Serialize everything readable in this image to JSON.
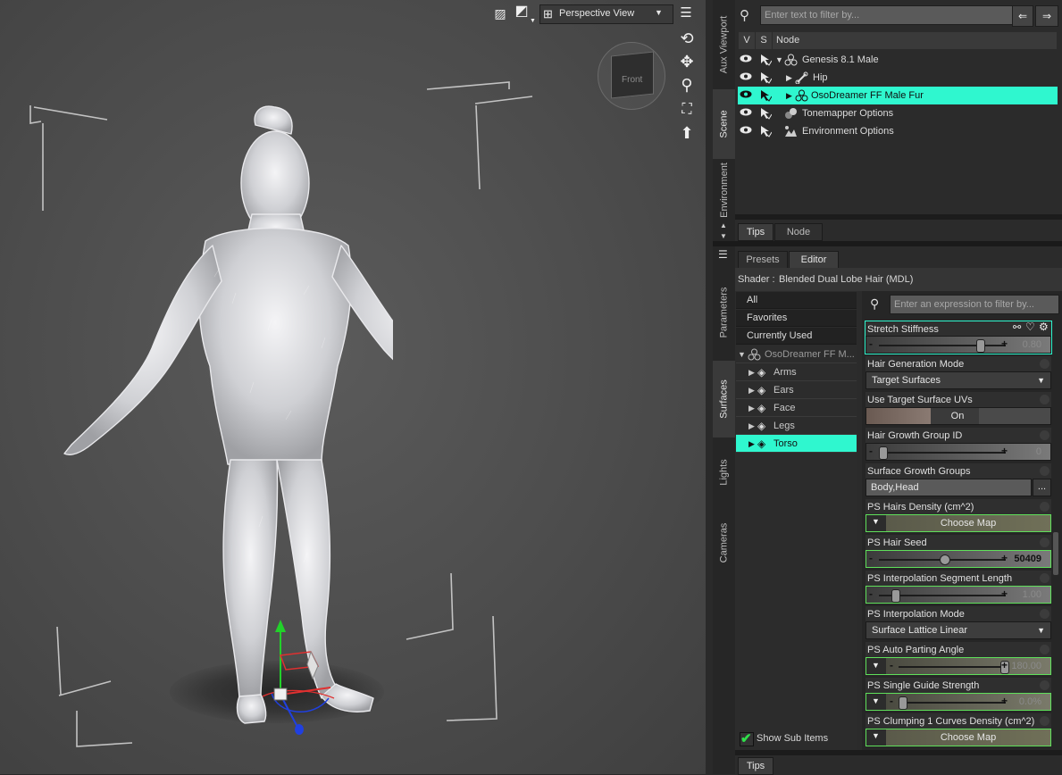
{
  "viewport": {
    "camera_label": "Perspective View",
    "navcube_label": "Front",
    "icons": [
      "render-icon",
      "shading-icon",
      "camera-icon",
      "viewport-menu-icon",
      "orbit-icon",
      "pan-icon",
      "zoom-icon",
      "frame-icon",
      "reset-icon"
    ]
  },
  "side_tabs_upper": [
    "Aux Viewport",
    "Scene",
    "Environment"
  ],
  "side_tabs_lower": [
    "Parameters",
    "Surfaces",
    "Lights",
    "Cameras"
  ],
  "scene": {
    "filter_placeholder": "Enter text to filter by...",
    "columns": {
      "v": "V",
      "s": "S",
      "node": "Node"
    },
    "nodes": [
      {
        "label": "Genesis 8.1 Male",
        "expanded": true,
        "selected": false,
        "icon": "figure-icon"
      },
      {
        "label": "Hip",
        "expanded": false,
        "selected": false,
        "icon": "bone-icon"
      },
      {
        "label": "OsoDreamer FF Male Fur",
        "expanded": false,
        "selected": true,
        "icon": "figure-icon"
      },
      {
        "label": "Tonemapper Options",
        "expanded": false,
        "selected": false,
        "icon": "tonemapper-icon"
      },
      {
        "label": "Environment Options",
        "expanded": false,
        "selected": false,
        "icon": "environment-icon"
      }
    ],
    "bottom_tabs": [
      "Tips",
      "Node"
    ]
  },
  "surfaces": {
    "tabs": [
      "Presets",
      "Editor"
    ],
    "active_tab": "Editor",
    "shader_label": "Shader :",
    "shader_name": "Blended Dual Lobe Hair (MDL)",
    "filters": [
      "All",
      "Favorites",
      "Currently Used"
    ],
    "group": "OsoDreamer FF M...",
    "items": [
      "Arms",
      "Ears",
      "Face",
      "Legs",
      "Torso"
    ],
    "selected_item": "Torso",
    "filter_placeholder": "Enter an expression to filter by...",
    "show_sub_items": "Show Sub Items",
    "bottom_tab": "Tips",
    "properties": [
      {
        "label": "Stretch Stiffness",
        "kind": "slider",
        "value": "0.80",
        "fraction": 0.8,
        "highlight": false
      },
      {
        "label": "Hair Generation Mode",
        "kind": "dropdown",
        "value": "Target Surfaces"
      },
      {
        "label": "Use Target Surface UVs",
        "kind": "toggle",
        "value": "On"
      },
      {
        "label": "Hair Growth Group ID",
        "kind": "slider",
        "value": "0",
        "fraction": 0.0,
        "highlight": false
      },
      {
        "label": "Surface Growth Groups",
        "kind": "text",
        "value": "Body,Head",
        "button": "..."
      },
      {
        "label": "PS Hairs Density (cm^2)",
        "kind": "map",
        "value": "Choose Map"
      },
      {
        "label": "PS Hair Seed",
        "kind": "slider",
        "value": "50409",
        "fraction": 0.5,
        "highlight": true,
        "bold": true
      },
      {
        "label": "PS Interpolation Segment Length",
        "kind": "slider",
        "value": "1.00",
        "fraction": 0.1,
        "highlight": true
      },
      {
        "label": "PS Interpolation Mode",
        "kind": "dropdown",
        "value": "Surface Lattice Linear"
      },
      {
        "label": "PS Auto Parting Angle",
        "kind": "slider-map",
        "value": "180.00",
        "fraction": 1.0,
        "highlight": true
      },
      {
        "label": "PS Single Guide Strength",
        "kind": "slider-map",
        "value": "0.0%",
        "fraction": 0.0,
        "highlight": true
      },
      {
        "label": "PS Clumping 1 Curves Density (cm^2)",
        "kind": "map",
        "value": "Choose Map"
      }
    ]
  },
  "colors": {
    "selection": "#2ff7cf",
    "highlight_border": "#5fe05a"
  }
}
